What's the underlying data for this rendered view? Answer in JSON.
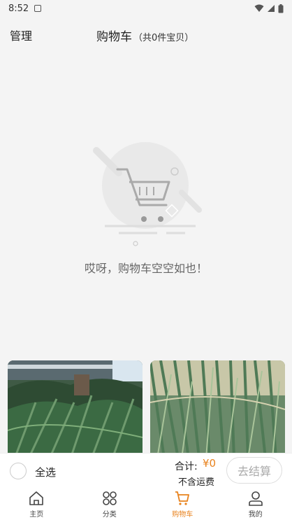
{
  "status_bar": {
    "time": "8:52"
  },
  "header": {
    "manage_label": "管理",
    "title": "购物车",
    "subtitle": "（共0件宝贝）"
  },
  "empty_state": {
    "message": "哎呀，购物车空空如也！"
  },
  "checkout": {
    "select_all_label": "全选",
    "total_label": "合计:",
    "total_value": "¥0",
    "shipping_note": "不含运费",
    "checkout_label": "去结算"
  },
  "nav": {
    "items": [
      {
        "label": "主页",
        "icon": "home-icon"
      },
      {
        "label": "分类",
        "icon": "category-icon"
      },
      {
        "label": "购物车",
        "icon": "cart-icon",
        "active": true
      },
      {
        "label": "我的",
        "icon": "profile-icon"
      }
    ]
  },
  "colors": {
    "accent": "#e8821d",
    "background": "#f4f4f4"
  }
}
